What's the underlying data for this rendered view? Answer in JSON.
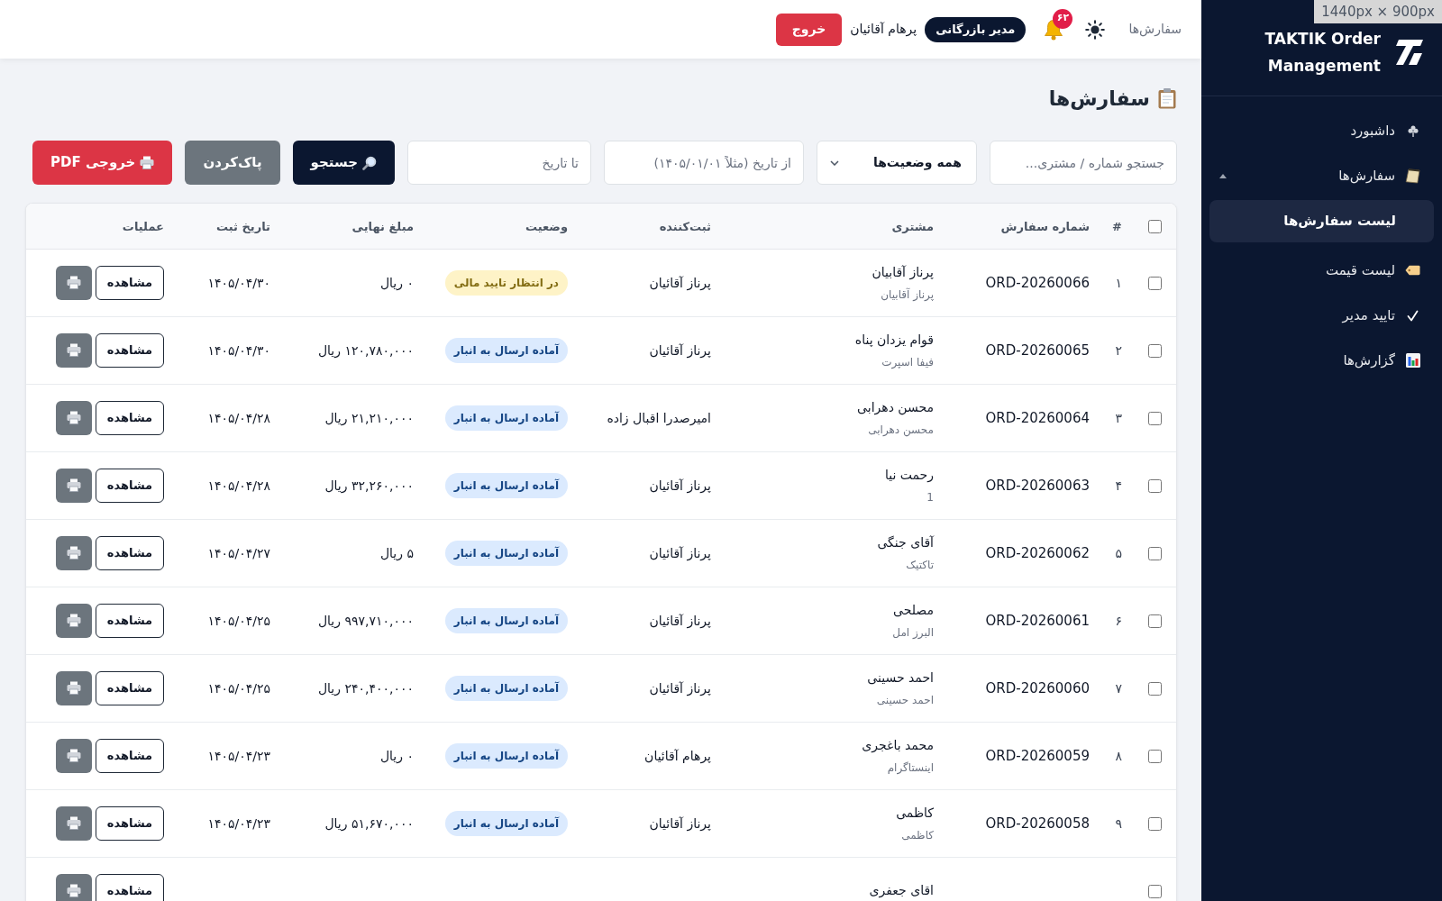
{
  "viewport_label": "1440px × 900px",
  "sidebar": {
    "brand": "TAKTIK Order Management",
    "items": [
      {
        "label": "داشبورد",
        "selected": false
      },
      {
        "label": "سفارش‌ها",
        "selected": false,
        "expanded": true,
        "children": [
          {
            "label": "لیست سفارش‌ها",
            "selected": true
          }
        ]
      },
      {
        "label": "لیست قیمت",
        "selected": false
      },
      {
        "label": "تایید مدیر",
        "selected": false
      },
      {
        "label": "گزارش‌ها",
        "selected": false
      }
    ]
  },
  "topbar": {
    "breadcrumb": "سفارش‌ها",
    "notification_count": "۶۲",
    "role": "مدیر بازرگانی",
    "user_name": "پرهام آقائیان",
    "logout": "خروج"
  },
  "page": {
    "title": "سفارش‌ها"
  },
  "filters": {
    "search": {
      "placeholder": "جستجو شماره / مشتری..."
    },
    "status": {
      "value": "همه وضعیت‌ها"
    },
    "date_from": {
      "placeholder": "از تاریخ (مثلاً ۱۴۰۵/۰۱/۰۱)"
    },
    "date_to": {
      "placeholder": "تا تاریخ"
    },
    "buttons": [
      {
        "label": "جستجو",
        "kind": "search"
      },
      {
        "label": "پاک‌کردن",
        "kind": "clear"
      },
      {
        "label": "خروجی PDF",
        "kind": "export"
      }
    ]
  },
  "table": {
    "select_all_checked": false,
    "columns": [
      "#",
      "شماره سفارش",
      "مشتری",
      "ثبت‌کننده",
      "وضعیت",
      "مبلغ نهایی",
      "تاریخ ثبت",
      "عملیات"
    ],
    "rows": [
      {
        "checked": false,
        "index": "۱",
        "order_no": "ORD-20260066",
        "customer": "پرناز آقابیان",
        "customer_sub": "پرناز آقابیان",
        "creator": "پرناز آقائیان",
        "status": {
          "label": "در انتظار تایید مالی",
          "color": "#fef3c7"
        },
        "amount": "۰ ریال",
        "date": "۱۴۰۵/۰۴/۳۰",
        "view_label": "مشاهده"
      },
      {
        "checked": false,
        "index": "۲",
        "order_no": "ORD-20260065",
        "customer": "قوام یزدان پناه",
        "customer_sub": "فیفا اسپرت",
        "creator": "پرناز آقائیان",
        "status": {
          "label": "آماده ارسال به انبار",
          "color": "#dbeafe"
        },
        "amount": "۱۲۰,۷۸۰,۰۰۰ ریال",
        "date": "۱۴۰۵/۰۴/۳۰",
        "view_label": "مشاهده"
      },
      {
        "checked": false,
        "index": "۳",
        "order_no": "ORD-20260064",
        "customer": "محسن دهرابی",
        "customer_sub": "محسن دهرابی",
        "creator": "امیرصدرا اقبال زاده",
        "status": {
          "label": "آماده ارسال به انبار",
          "color": "#dbeafe"
        },
        "amount": "۲۱,۲۱۰,۰۰۰ ریال",
        "date": "۱۴۰۵/۰۴/۲۸",
        "view_label": "مشاهده"
      },
      {
        "checked": false,
        "index": "۴",
        "order_no": "ORD-20260063",
        "customer": "رحمت نیا",
        "customer_sub": "1",
        "creator": "پرناز آقائیان",
        "status": {
          "label": "آماده ارسال به انبار",
          "color": "#dbeafe"
        },
        "amount": "۳۲,۲۶۰,۰۰۰ ریال",
        "date": "۱۴۰۵/۰۴/۲۸",
        "view_label": "مشاهده"
      },
      {
        "checked": false,
        "index": "۵",
        "order_no": "ORD-20260062",
        "customer": "آقای جنگی",
        "customer_sub": "تاکتیک",
        "creator": "پرناز آقائیان",
        "status": {
          "label": "آماده ارسال به انبار",
          "color": "#dbeafe"
        },
        "amount": "۵ ریال",
        "date": "۱۴۰۵/۰۴/۲۷",
        "view_label": "مشاهده"
      },
      {
        "checked": false,
        "index": "۶",
        "order_no": "ORD-20260061",
        "customer": "مصلحی",
        "customer_sub": "البرز امل",
        "creator": "پرناز آقائیان",
        "status": {
          "label": "آماده ارسال به انبار",
          "color": "#dbeafe"
        },
        "amount": "۹۹۷,۷۱۰,۰۰۰ ریال",
        "date": "۱۴۰۵/۰۴/۲۵",
        "view_label": "مشاهده"
      },
      {
        "checked": false,
        "index": "۷",
        "order_no": "ORD-20260060",
        "customer": "احمد حسینی",
        "customer_sub": "احمد حسینی",
        "creator": "پرناز آقائیان",
        "status": {
          "label": "آماده ارسال به انبار",
          "color": "#dbeafe"
        },
        "amount": "۲۴۰,۴۰۰,۰۰۰ ریال",
        "date": "۱۴۰۵/۰۴/۲۵",
        "view_label": "مشاهده"
      },
      {
        "checked": false,
        "index": "۸",
        "order_no": "ORD-20260059",
        "customer": "محمد باغجری",
        "customer_sub": "اینستاگرام",
        "creator": "پرهام آقائیان",
        "status": {
          "label": "آماده ارسال به انبار",
          "color": "#dbeafe"
        },
        "amount": "۰ ریال",
        "date": "۱۴۰۵/۰۴/۲۳",
        "view_label": "مشاهده"
      },
      {
        "checked": false,
        "index": "۹",
        "order_no": "ORD-20260058",
        "customer": "کاظمی",
        "customer_sub": "کاظمی",
        "creator": "پرناز آقائیان",
        "status": {
          "label": "آماده ارسال به انبار",
          "color": "#dbeafe"
        },
        "amount": "۵۱,۶۷۰,۰۰۰ ریال",
        "date": "۱۴۰۵/۰۴/۲۳",
        "view_label": "مشاهده"
      },
      {
        "checked": false,
        "customer": "اقای جعفری",
        "view_label": "مشاهده"
      }
    ]
  }
}
